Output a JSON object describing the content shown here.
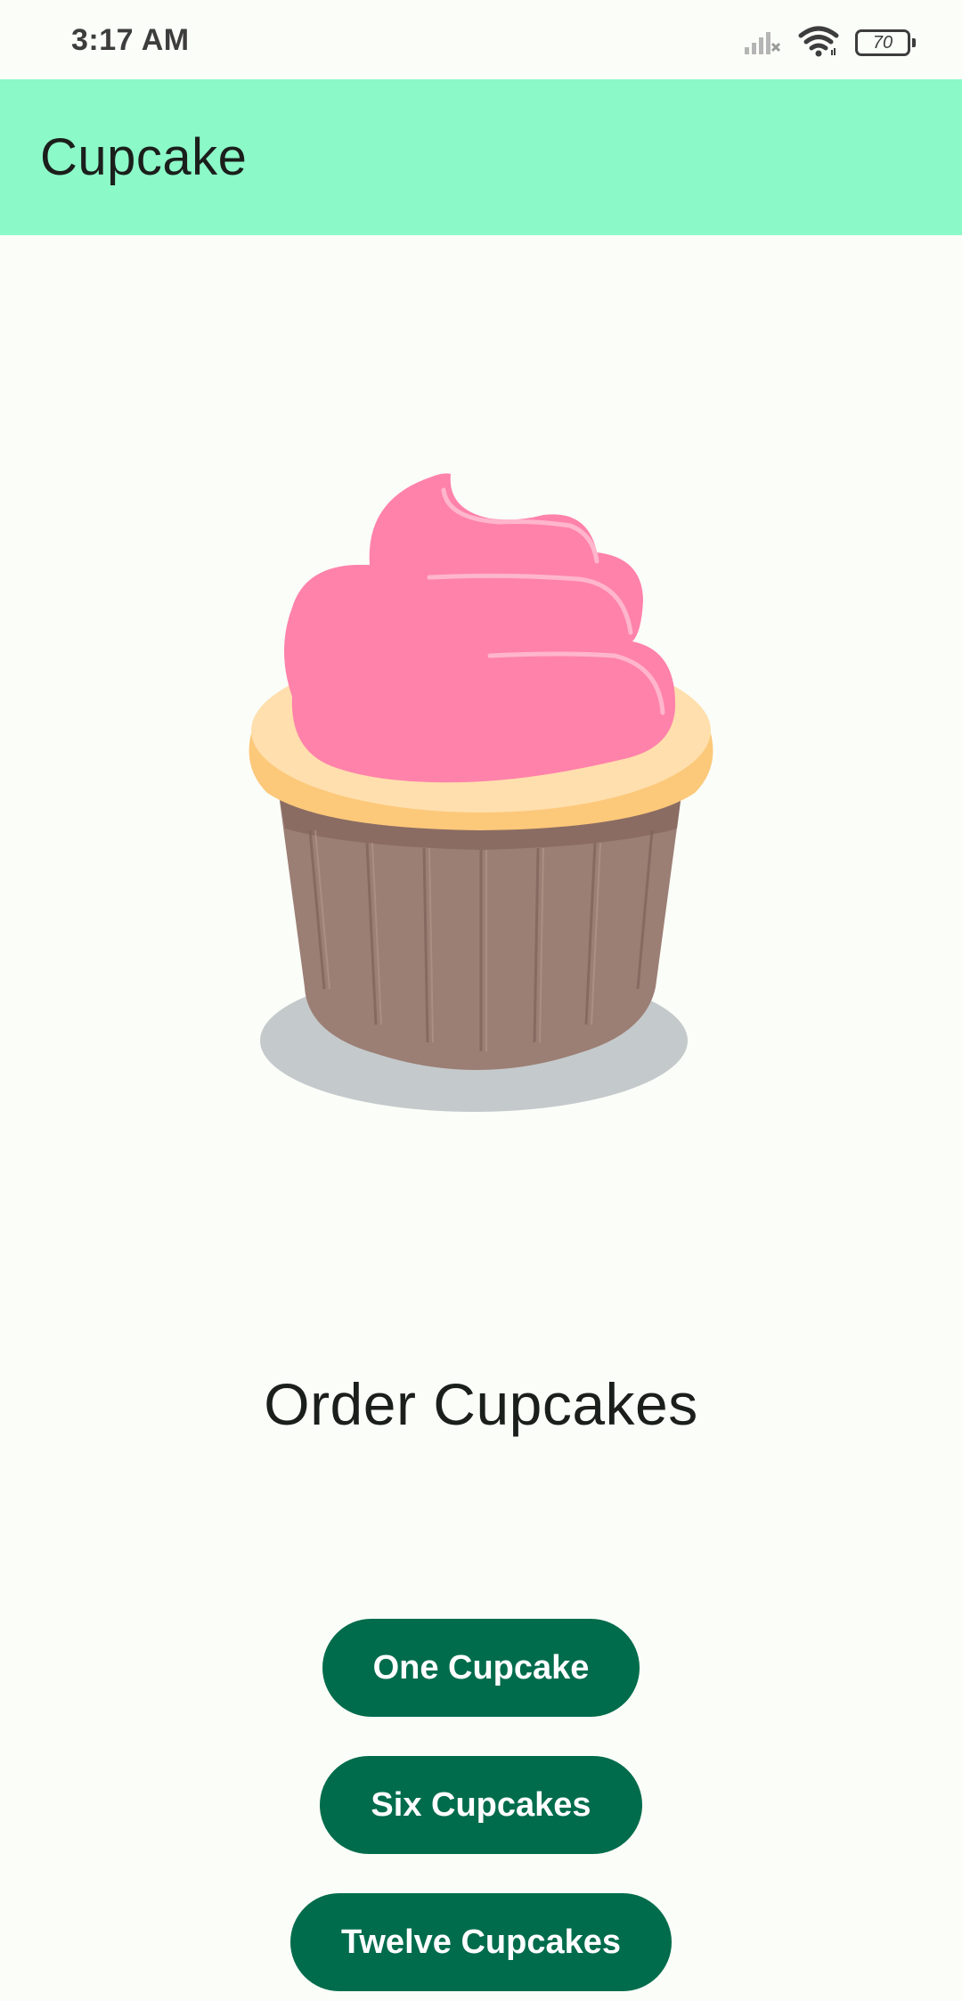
{
  "status_bar": {
    "time": "3:17 AM",
    "battery_level": "70",
    "icons": [
      "signal-off-icon",
      "wifi-icon",
      "battery-icon"
    ]
  },
  "app_bar": {
    "title": "Cupcake",
    "background_color": "#8cf9c8"
  },
  "main": {
    "image": "cupcake-illustration",
    "heading": "Order Cupcakes"
  },
  "buttons": {
    "one": "One Cupcake",
    "six": "Six Cupcakes",
    "twelve": "Twelve Cupcakes",
    "color": "#006c4c"
  }
}
